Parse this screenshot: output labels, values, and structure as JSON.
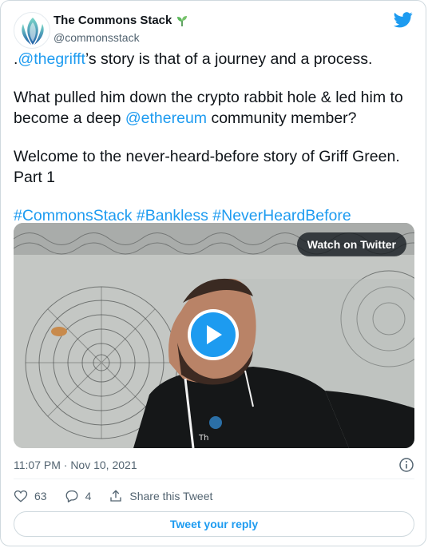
{
  "account": {
    "display_name": "The Commons Stack",
    "handle": "@commonsstack",
    "avatar_icon": "commons-stack-logo-icon",
    "badge_icon": "sprout-icon"
  },
  "tweet": {
    "p1_prefix": ".",
    "p1_mention": "@thegrifft",
    "p1_suffix": "’s story is that of a journey and a process.",
    "p2_text": "What pulled him down the crypto rabbit hole & led him to become a deep ",
    "p2_mention": "@ethereum",
    "p2_suffix": " community member?",
    "p3_text": "Welcome to the never-heard-before story of Griff Green. Part 1",
    "hashtag1": "#CommonsStack",
    "hashtag2": "#Bankless",
    "hashtag3": "#NeverHeardBefore"
  },
  "media": {
    "watch_label": "Watch on Twitter",
    "play_icon": "play-icon"
  },
  "meta": {
    "timestamp": "11:07 PM · Nov 10, 2021",
    "info_icon": "info-icon"
  },
  "actions": {
    "like_count": "63",
    "reply_count": "4",
    "share_label": "Share this Tweet"
  },
  "reply_button_label": "Tweet your reply",
  "colors": {
    "link": "#1d9bf0",
    "text": "#0f1419",
    "secondary": "#536471"
  }
}
